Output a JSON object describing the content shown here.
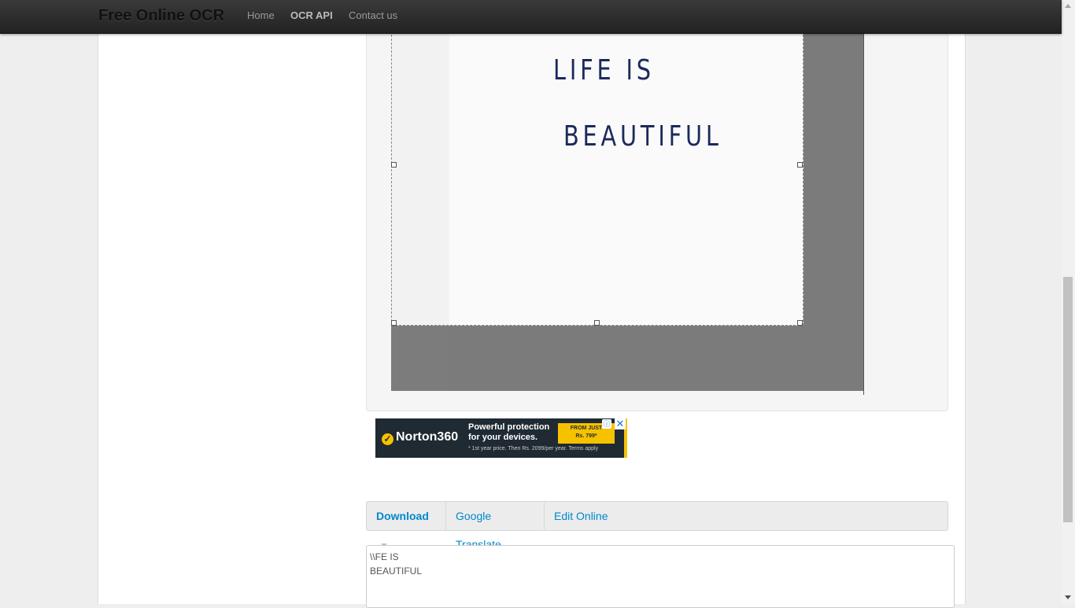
{
  "navbar": {
    "brand": "Free Online OCR",
    "links": [
      {
        "label": "Home",
        "active": false
      },
      {
        "label": "OCR API",
        "active": true
      },
      {
        "label": "Contact us",
        "active": false
      }
    ]
  },
  "image": {
    "handwritten_line_1": "LIFE  IS",
    "handwritten_line_2": "BEAUTIFUL"
  },
  "ad": {
    "brand": "Norton360",
    "headline": "Powerful protection for your devices.",
    "price_line_1": "FROM JUST",
    "price_line_2": "Rs. 799*",
    "footnote": "* 1st year price. Then Rs. 2099/per year. Terms apply",
    "info_icon": "info-icon",
    "close_icon": "close-icon",
    "accent_color": "#f6c200"
  },
  "toolbar": {
    "download_label": "Download",
    "translate_label": "Google Translate",
    "edit_label": "Edit Online"
  },
  "result": {
    "text": "\\\\FE IS\nBEAUTIFUL"
  }
}
